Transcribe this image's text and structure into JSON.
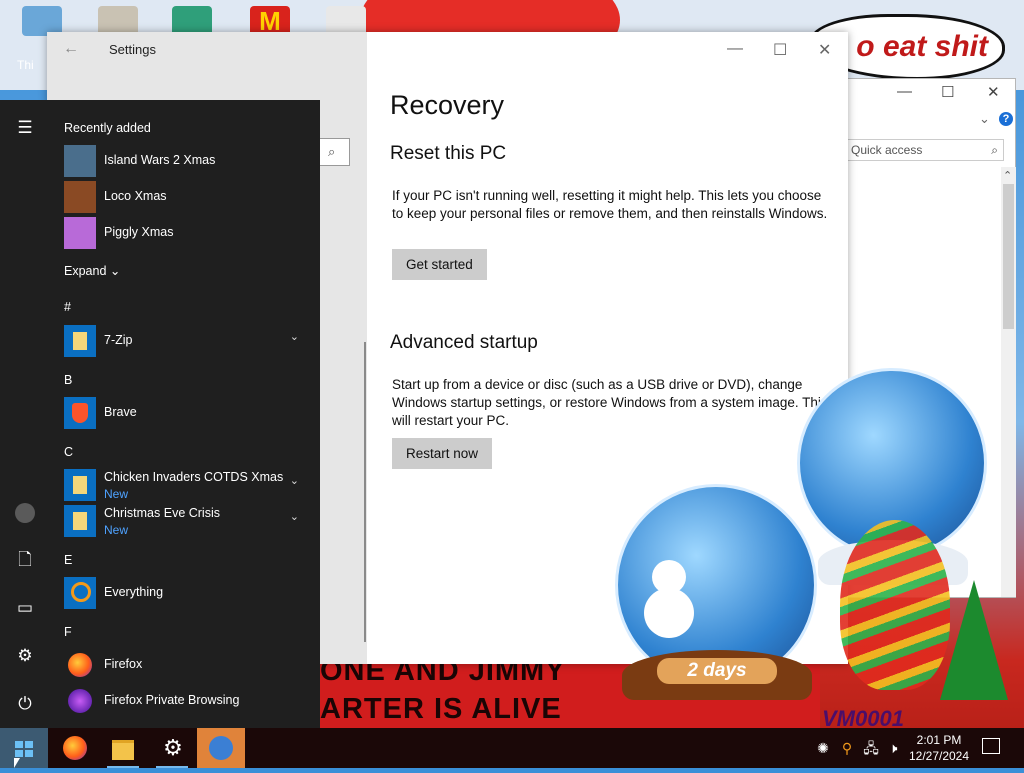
{
  "desktop": {
    "icon_label": "Thi",
    "sign_text": "o eat shit",
    "banner_line1": "ONE AND JIMMY",
    "banner_line2": "ARTER IS ALIVE",
    "vm_text": "VM0001",
    "globe_plaque": "2 days"
  },
  "explorer": {
    "quick_access_placeholder": "Quick access",
    "help_label": "?"
  },
  "settings": {
    "window_title": "Settings",
    "page_title": "Recovery",
    "reset": {
      "heading": "Reset this PC",
      "description": "If your PC isn't running well, resetting it might help. This lets you choose to keep your personal files or remove them, and then reinstalls Windows.",
      "button": "Get started"
    },
    "advanced": {
      "heading": "Advanced startup",
      "description": "Start up from a device or disc (such as a USB drive or DVD), change Windows startup settings, or restore Windows from a system image. This will restart your PC.",
      "button": "Restart now"
    }
  },
  "start_menu": {
    "recently_added_label": "Recently added",
    "recent_apps": [
      {
        "name": "Island Wars 2 Xmas"
      },
      {
        "name": "Loco Xmas"
      },
      {
        "name": "Piggly Xmas"
      }
    ],
    "expand_label": "Expand",
    "sections": {
      "hash": "#",
      "b": "B",
      "c": "C",
      "e": "E",
      "f": "F"
    },
    "apps": {
      "sevenzip": {
        "name": "7-Zip"
      },
      "brave": {
        "name": "Brave"
      },
      "chicken": {
        "name": "Chicken Invaders COTDS Xmas",
        "badge": "New"
      },
      "christmas": {
        "name": "Christmas Eve Crisis",
        "badge": "New"
      },
      "everything": {
        "name": "Everything"
      },
      "firefox": {
        "name": "Firefox"
      },
      "firefox_private": {
        "name": "Firefox Private Browsing"
      }
    }
  },
  "taskbar": {
    "time": "2:01 PM",
    "date": "12/27/2024"
  },
  "colors": {
    "accent_blue": "#4ea2ff",
    "start_bg": "#1f1f1f",
    "button_gray": "#cccccc"
  }
}
